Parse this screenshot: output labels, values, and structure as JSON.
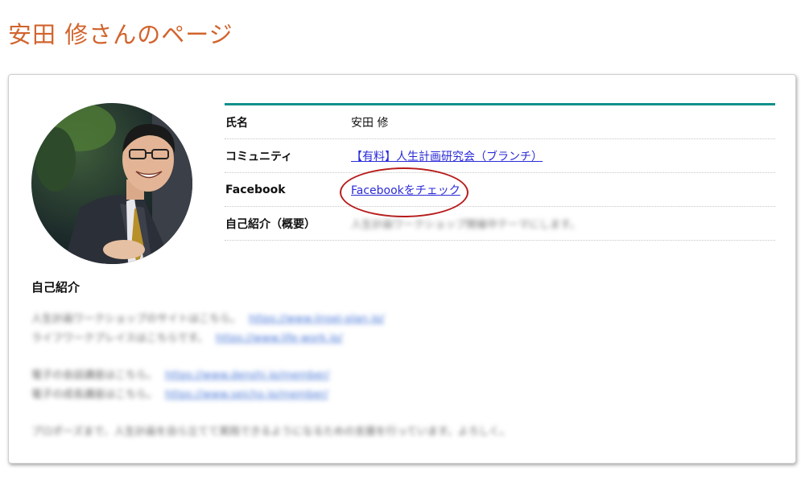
{
  "page": {
    "title": "安田 修さんのページ"
  },
  "profile": {
    "rows": [
      {
        "label": "氏名",
        "value": "安田 修"
      },
      {
        "label": "コミュニティ",
        "value": "【有料】人生計画研究会（ブランチ）"
      },
      {
        "label": "Facebook",
        "value": "Facebookをチェック"
      },
      {
        "label": "自己紹介（概要）",
        "value": "人生計画ワークショップ開催中テーマにします。"
      }
    ]
  },
  "intro": {
    "title": "自己紹介",
    "paragraphs": [
      {
        "lines": [
          {
            "text": "人生計画ワークショップのサイトはこちら。",
            "link": "https://www.jinsei-plan.jp/"
          },
          {
            "text": "ライフワークプレイスはこちらです。",
            "link": "https://www.life-work.jp/"
          }
        ]
      },
      {
        "lines": [
          {
            "text": "電子の会話講座はこちら。",
            "link": "https://www.denshi.jp/member/"
          },
          {
            "text": "電子の成長講座はこちら。",
            "link": "https://www.seicho.jp/member/"
          }
        ]
      },
      {
        "lines": [
          {
            "text": "プロポーズまで、人生計画を自ら立てて実践できるようになるための支援を行っています。よろしく。",
            "link": ""
          }
        ]
      }
    ]
  },
  "colors": {
    "title": "#d2642e",
    "accent": "#12908b",
    "annotation": "#b81c1c",
    "link": "#2a2ad8"
  }
}
